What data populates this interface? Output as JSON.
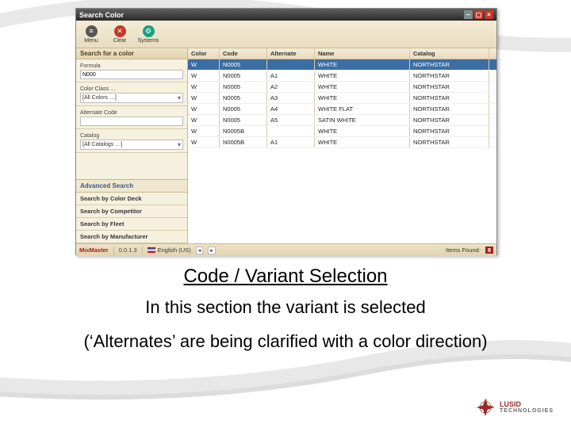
{
  "window": {
    "title": "Search Color"
  },
  "toolbar": {
    "menu": "Menu",
    "clear": "Clear",
    "systems": "Systems"
  },
  "sidebar": {
    "search_header": "Search for a color",
    "formula_label": "Formula",
    "formula_value": "N000",
    "colorclass_label": "Color Class …",
    "colorclass_value": "[All Colors …]",
    "altcode_label": "Alternate Code",
    "altcode_value": "",
    "catalog_label": "Catalog",
    "catalog_value": "[All Catalogs …]",
    "advanced_header": "Advanced Search",
    "adv_items": [
      "Search by Color Deck",
      "Search by Competitor",
      "Search by Fleet",
      "Search by Manufacturer"
    ]
  },
  "table": {
    "headers": {
      "color": "Color",
      "code": "Code",
      "alternate": "Alternate",
      "name": "Name",
      "catalog": "Catalog"
    },
    "rows": [
      {
        "color": "W",
        "code": "N0005",
        "alt": "",
        "name": "WHITE",
        "catalog": "NORTHSTAR",
        "sel": true
      },
      {
        "color": "W",
        "code": "N0005",
        "alt": "A1",
        "name": "WHITE",
        "catalog": "NORTHSTAR"
      },
      {
        "color": "W",
        "code": "N0005",
        "alt": "A2",
        "name": "WHITE",
        "catalog": "NORTHSTAR"
      },
      {
        "color": "W",
        "code": "N0005",
        "alt": "A3",
        "name": "WHITE",
        "catalog": "NORTHSTAR"
      },
      {
        "color": "W",
        "code": "N0005",
        "alt": "A4",
        "name": "WHITE FLAT",
        "catalog": "NORTHSTAR"
      },
      {
        "color": "W",
        "code": "N0005",
        "alt": "A5",
        "name": "SATIN WHITE",
        "catalog": "NORTHSTAR"
      },
      {
        "color": "W",
        "code": "N0005B",
        "alt": "",
        "name": "WHITE",
        "catalog": "NORTHSTAR"
      },
      {
        "color": "W",
        "code": "N0005B",
        "alt": "A1",
        "name": "WHITE",
        "catalog": "NORTHSTAR"
      }
    ]
  },
  "status": {
    "app": "MixMaster",
    "version": "0.0.1.3",
    "lang": "English (US)",
    "items_found_label": "Items Found:",
    "items_found": "8"
  },
  "captions": {
    "line1": "Code / Variant Selection",
    "line2": "In this section the variant is selected",
    "line3": "(‘Alternates’ are being clarified with a color direction)"
  },
  "logo": {
    "line1": "LUSID",
    "line2": "TECHNOLOGIES"
  }
}
